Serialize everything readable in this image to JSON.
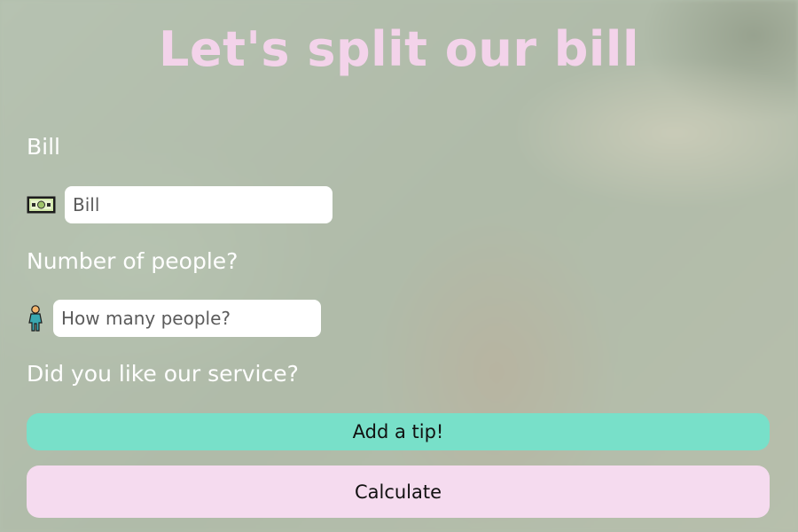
{
  "header": {
    "title": "Let's split our bill"
  },
  "bill": {
    "label": "Bill",
    "icon": "money-icon",
    "placeholder": "Bill",
    "value": ""
  },
  "people": {
    "label": "Number of people?",
    "icon": "person-icon",
    "placeholder": "How many people?",
    "value": ""
  },
  "service": {
    "question": "Did you like our service?"
  },
  "buttons": {
    "tip_label": "Add a tip!",
    "calculate_label": "Calculate"
  },
  "colors": {
    "title": "#f3d3ea",
    "tip_button": "#78e0c9",
    "calculate_button": "#f5dbef",
    "label_text": "#ffffff"
  }
}
